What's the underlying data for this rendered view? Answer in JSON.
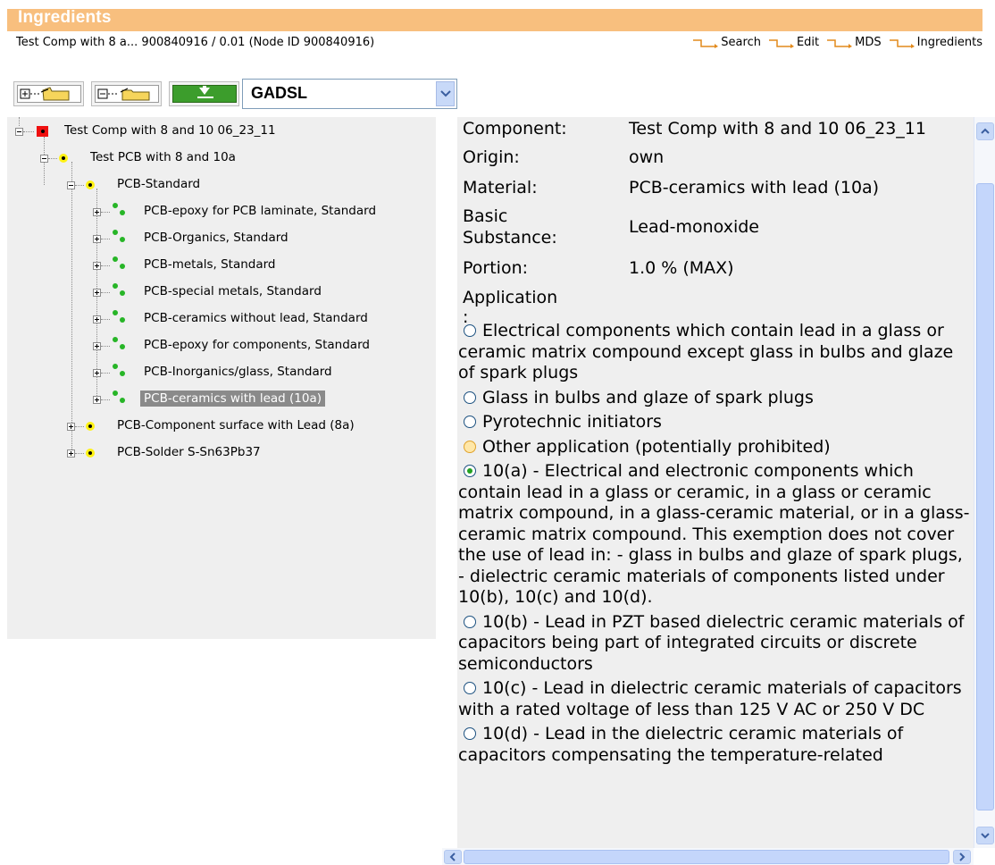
{
  "header": {
    "title": "Ingredients",
    "subtitle": "Test Comp with 8 a... 900840916 / 0.01 (Node ID 900840916)",
    "breadcrumbs": [
      "Search",
      "Edit",
      "MDS",
      "Ingredients"
    ]
  },
  "toolbar": {
    "buttons": [
      "expand-all",
      "collapse-all",
      "download"
    ],
    "select_value": "GADSL"
  },
  "tree": {
    "root": "Test Comp with 8 and 10 06_23_11",
    "pcb": "Test PCB with 8 and 10a",
    "standard": "PCB-Standard",
    "children": [
      "PCB-epoxy for PCB laminate, Standard",
      "PCB-Organics, Standard",
      "PCB-metals, Standard",
      "PCB-special metals, Standard",
      "PCB-ceramics without lead, Standard",
      "PCB-epoxy for components, Standard",
      "PCB-Inorganics/glass, Standard",
      "PCB-ceramics with lead (10a)"
    ],
    "surface": "PCB-Component surface with Lead (8a)",
    "solder": "PCB-Solder S-Sn63Pb37"
  },
  "detail": {
    "component_label": "Component:",
    "component_value": "Test Comp with 8 and 10 06_23_11",
    "origin_label": "Origin:",
    "origin_value": "own",
    "material_label": "Material:",
    "material_value": "PCB-ceramics with lead (10a)",
    "basic_label_1": "Basic",
    "basic_label_2": "Substance:",
    "basic_value": "Lead-monoxide",
    "portion_label": "Portion:",
    "portion_value": "1.0 % (MAX)",
    "application_label": "Application :",
    "options": [
      "Electrical components which contain lead in a glass or ceramic matrix compound except glass in bulbs and glaze of spark plugs",
      "Glass in bulbs and glaze of spark plugs",
      "Pyrotechnic initiators",
      "Other application (potentially prohibited)",
      "10(a) - Electrical and electronic components which contain lead in a glass or ceramic, in a glass or ceramic matrix compound, in a glass-ceramic material, or in a glass-ceramic matrix compound. This exemption does not cover the use of lead in: - glass in bulbs and glaze of spark plugs, - dielectric ceramic materials of components listed under 10(b), 10(c) and 10(d).",
      "10(b) - Lead in PZT based dielectric ceramic materials of capacitors being part of integrated circuits or discrete semiconductors",
      "10(c) - Lead in dielectric ceramic materials of capacitors with a rated voltage of less than 125 V AC or 250 V DC",
      "10(d) - Lead in the dielectric ceramic materials of capacitors compensating the temperature-related"
    ],
    "selected_option": 4
  },
  "colors": {
    "header_bg": "#f8bf7e",
    "panel_bg": "#efefef",
    "selected_bg": "#8a8a8a"
  }
}
